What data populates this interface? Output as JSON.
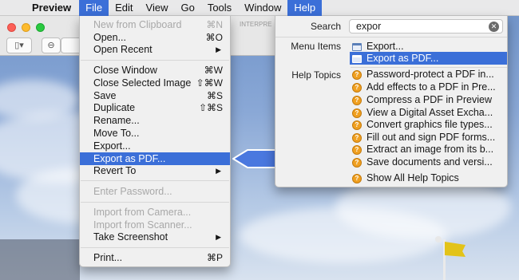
{
  "menubar": {
    "app": "Preview",
    "items": [
      "File",
      "Edit",
      "View",
      "Go",
      "Tools",
      "Window",
      "Help"
    ],
    "active": [
      "File",
      "Help"
    ]
  },
  "toolbar": {
    "sidebar_icon": "sidebar-toggle-icon",
    "zoom_icon": "zoom-out-icon"
  },
  "pdf_tab_text": "INTERPRE",
  "file_menu": {
    "items": [
      {
        "label": "New from Clipboard",
        "shortcut": "⌘N",
        "disabled": true
      },
      {
        "label": "Open...",
        "shortcut": "⌘O"
      },
      {
        "label": "Open Recent",
        "submenu": true
      },
      {
        "label": "Close Window",
        "shortcut": "⌘W"
      },
      {
        "label": "Close Selected Image",
        "shortcut": "⇧⌘W"
      },
      {
        "label": "Save",
        "shortcut": "⌘S"
      },
      {
        "label": "Duplicate",
        "shortcut": "⇧⌘S"
      },
      {
        "label": "Rename..."
      },
      {
        "label": "Move To..."
      },
      {
        "label": "Export..."
      },
      {
        "label": "Export as PDF...",
        "selected": true
      },
      {
        "label": "Revert To",
        "submenu": true
      },
      {
        "label": "Enter Password...",
        "disabled": true
      },
      {
        "label": "Import from Camera...",
        "disabled": true
      },
      {
        "label": "Import from Scanner...",
        "disabled": true
      },
      {
        "label": "Take Screenshot",
        "submenu": true
      },
      {
        "label": "Print...",
        "shortcut": "⌘P"
      }
    ]
  },
  "help_menu": {
    "search_label": "Search",
    "search_value": "expor",
    "menu_items_label": "Menu Items",
    "help_topics_label": "Help Topics",
    "menu_items": [
      {
        "label": "Export...",
        "icon": "menu-item-icon"
      },
      {
        "label": "Export as PDF...",
        "icon": "menu-item-icon",
        "selected": true
      }
    ],
    "help_topics": [
      {
        "label": "Password-protect a PDF in...",
        "icon": "help-topic-icon"
      },
      {
        "label": "Add effects to a PDF in Pre...",
        "icon": "help-topic-icon"
      },
      {
        "label": "Compress a PDF in Preview",
        "icon": "help-topic-icon"
      },
      {
        "label": "View a Digital Asset Excha...",
        "icon": "help-topic-icon"
      },
      {
        "label": "Convert graphics file types...",
        "icon": "help-topic-icon"
      },
      {
        "label": "Fill out and sign PDF forms...",
        "icon": "help-topic-icon"
      },
      {
        "label": "Extract an image from its b...",
        "icon": "help-topic-icon"
      },
      {
        "label": "Save documents and versi...",
        "icon": "help-topic-icon"
      }
    ],
    "show_all": "Show All Help Topics"
  },
  "colors": {
    "accent": "#3b6fd8",
    "pointer_fill": "#4a78df"
  }
}
